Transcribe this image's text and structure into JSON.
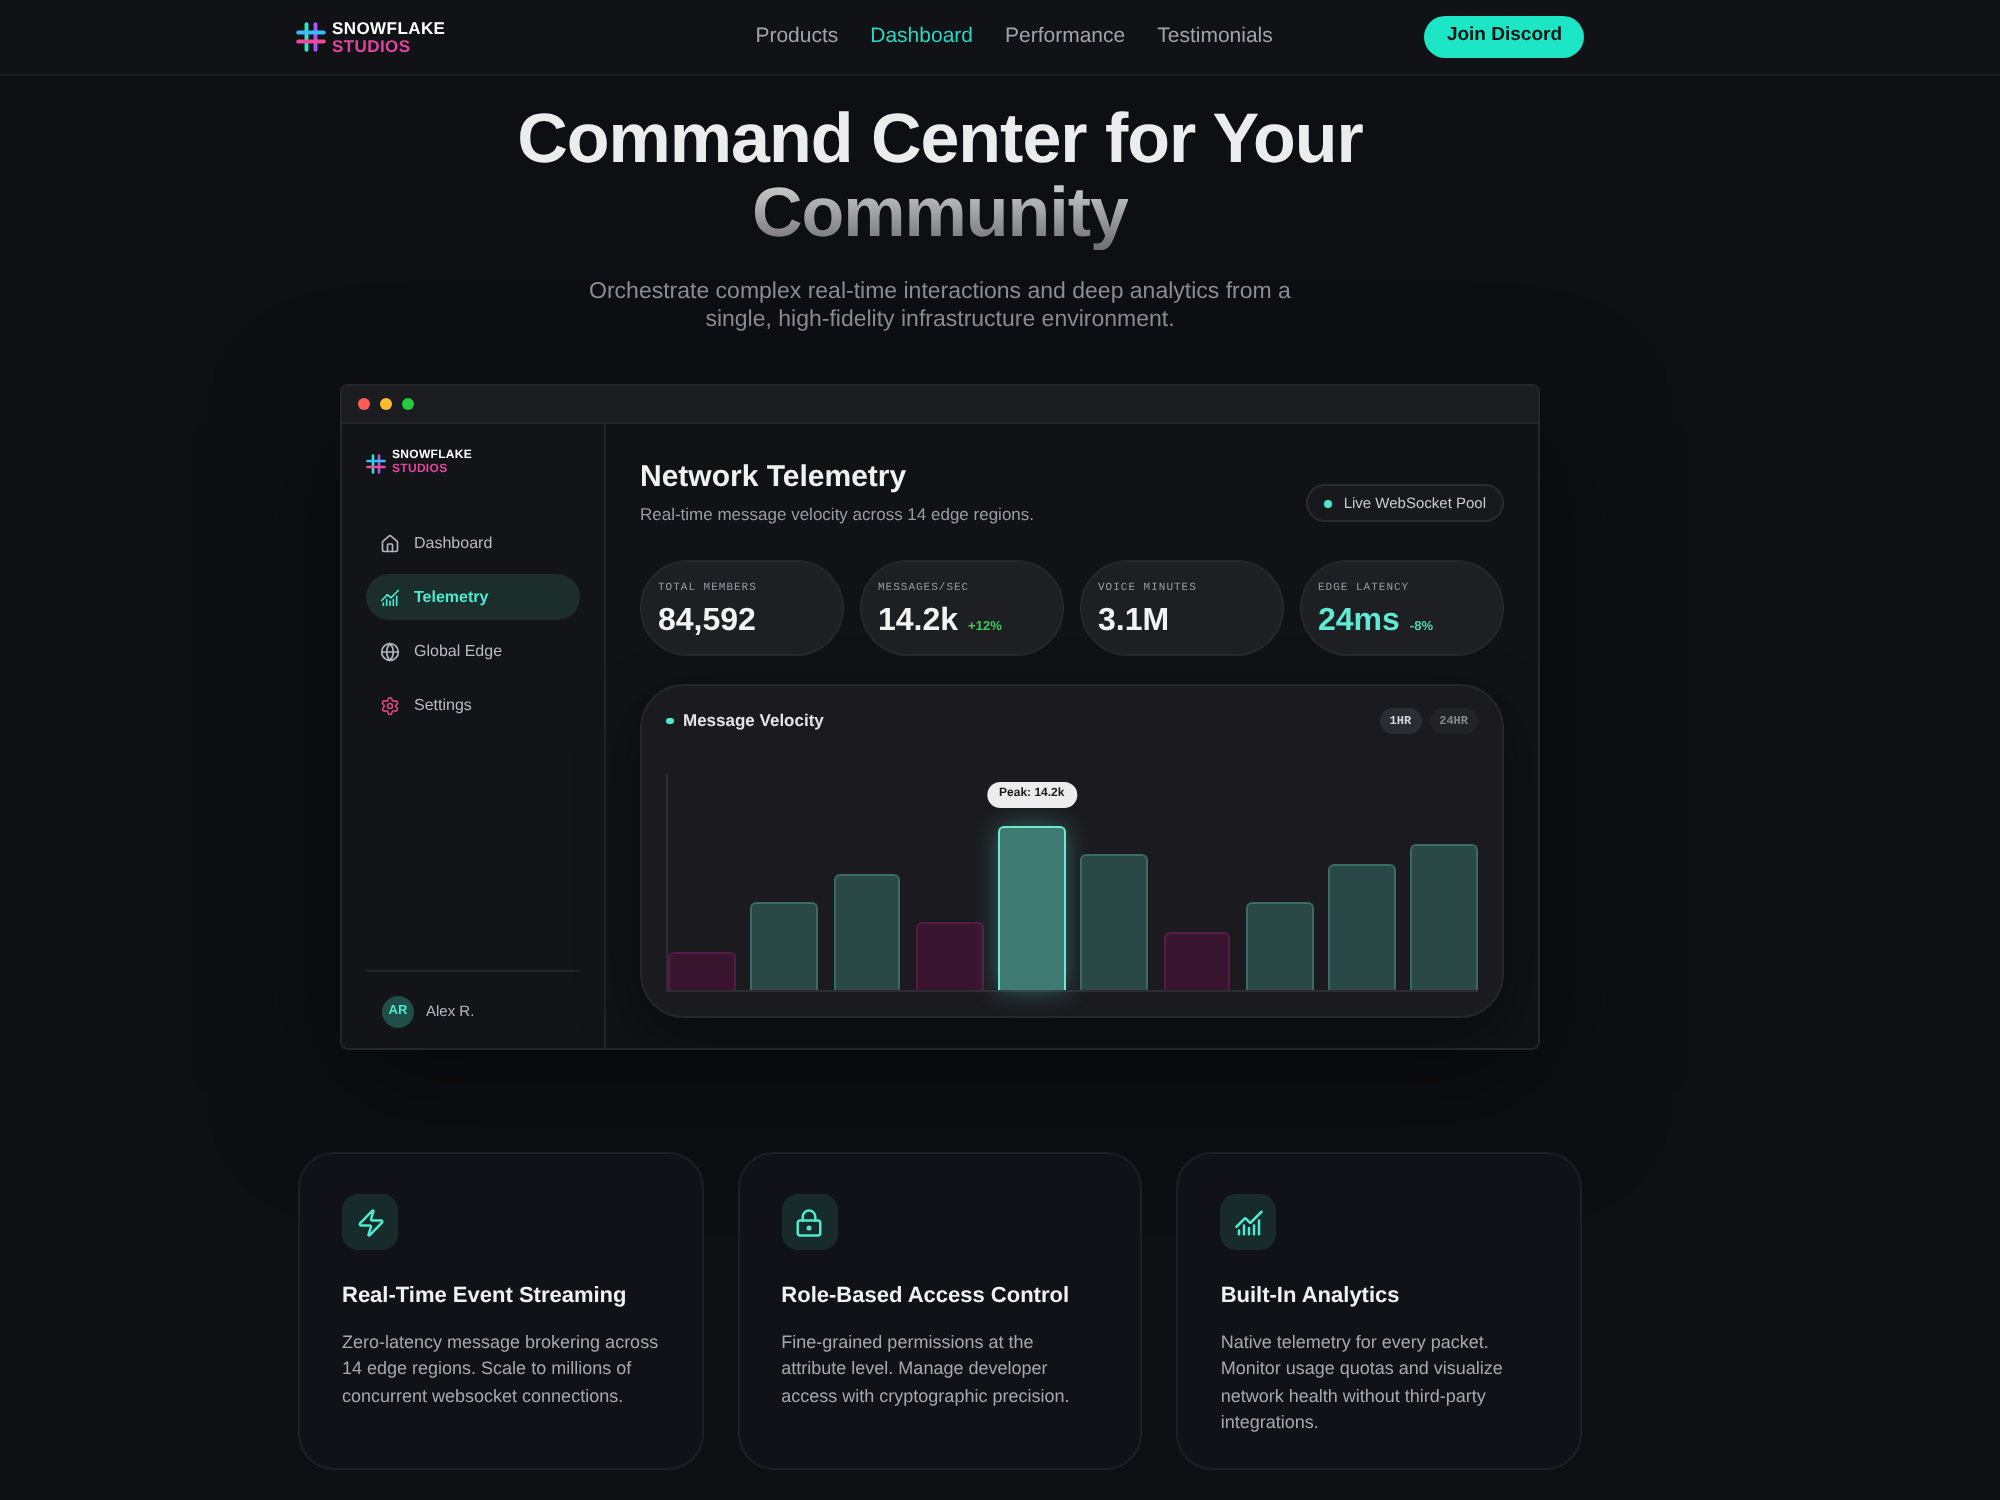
{
  "nav": {
    "logo": {
      "line_1": "SNOWFLAKE",
      "line_2": "STUDIOS"
    },
    "links": [
      {
        "label": "Products",
        "selected": false
      },
      {
        "label": "Dashboard",
        "selected": true
      },
      {
        "label": "Performance",
        "selected": false
      },
      {
        "label": "Testimonials",
        "selected": false
      }
    ],
    "cta": "Join Discord"
  },
  "hero": {
    "title_line_1": "Command Center for Your",
    "title_line_2": "Community",
    "subtitle": "Orchestrate complex real-time interactions and deep analytics from a single, high-fidelity infrastructure environment."
  },
  "app_window": {
    "sidebar": {
      "logo": {
        "line_1": "SNOWFLAKE",
        "line_2": "STUDIOS"
      },
      "items": [
        {
          "label": "Dashboard",
          "selected": false
        },
        {
          "label": "Telemetry",
          "selected": true
        },
        {
          "label": "Global Edge",
          "selected": false
        },
        {
          "label": "Settings",
          "selected": false
        }
      ],
      "user": {
        "initials": "AR",
        "name": "Alex R."
      }
    },
    "header": {
      "title": "Network Telemetry",
      "subtitle": "Real-time message velocity across 14 edge regions.",
      "badge": "Live WebSocket Pool"
    },
    "stats": [
      {
        "label": "TOTAL MEMBERS",
        "value": "84,592",
        "accent": false
      },
      {
        "label": "MESSAGES/SEC",
        "value": "14.2k",
        "accent": false,
        "delta": {
          "text": "+12%",
          "positive": true
        }
      },
      {
        "label": "VOICE MINUTES",
        "value": "3.1M",
        "accent": false
      },
      {
        "label": "EDGE LATENCY",
        "value": "24ms",
        "accent": true,
        "delta": {
          "text": "-8%",
          "positive": false
        }
      }
    ],
    "chart": {
      "title": "Message Velocity",
      "ranges": [
        {
          "label": "1HR",
          "selected": true
        },
        {
          "label": "24HR",
          "selected": false
        }
      ],
      "tooltip": "Peak: 14.2k"
    }
  },
  "features": [
    {
      "title": "Real-Time Event Streaming",
      "description": "Zero-latency message brokering across 14 edge regions. Scale to millions of concurrent websocket connections."
    },
    {
      "title": "Role-Based Access Control",
      "description": "Fine-grained permissions at the attribute level. Manage developer access with cryptographic precision."
    },
    {
      "title": "Built-In Analytics",
      "description": "Native telemetry for every packet. Monitor usage quotas and visualize network health without third-party integrations."
    }
  ]
}
